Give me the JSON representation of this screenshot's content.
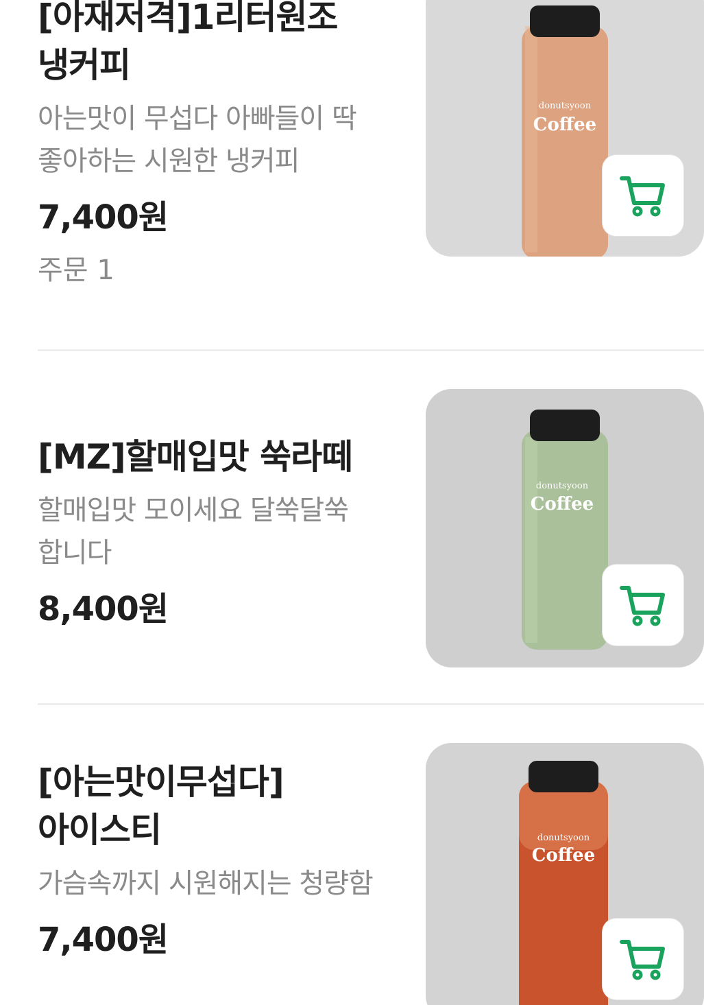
{
  "products": [
    {
      "name": "[아재저격]1리터원조 냉커피",
      "description": "아는맛이 무섭다 아빠들이 딱좋아하는 시원한 냉커피",
      "price": "7,400원",
      "orders": "주문 1",
      "image": {
        "brand_small": "donutsyoon",
        "brand_large": "Coffee",
        "drink_color": "#d9a07e"
      }
    },
    {
      "name": "[MZ]할매입맛 쑥라떼",
      "description": "할매입맛 모이세요 달쑥달쑥 합니다",
      "price": "8,400원",
      "image": {
        "brand_small": "donutsyoon",
        "brand_large": "Coffee",
        "drink_color": "#a7bf98"
      }
    },
    {
      "name": "[아는맛이무섭다]아이스티",
      "description": "가슴속까지 시원해지는 청량함",
      "price": "7,400원",
      "image": {
        "brand_small": "donutsyoon",
        "brand_large": "Coffee",
        "drink_color": "#c8502a"
      }
    }
  ],
  "icons": {
    "cart": "cart-icon"
  },
  "colors": {
    "accent_green": "#1aa35c"
  }
}
